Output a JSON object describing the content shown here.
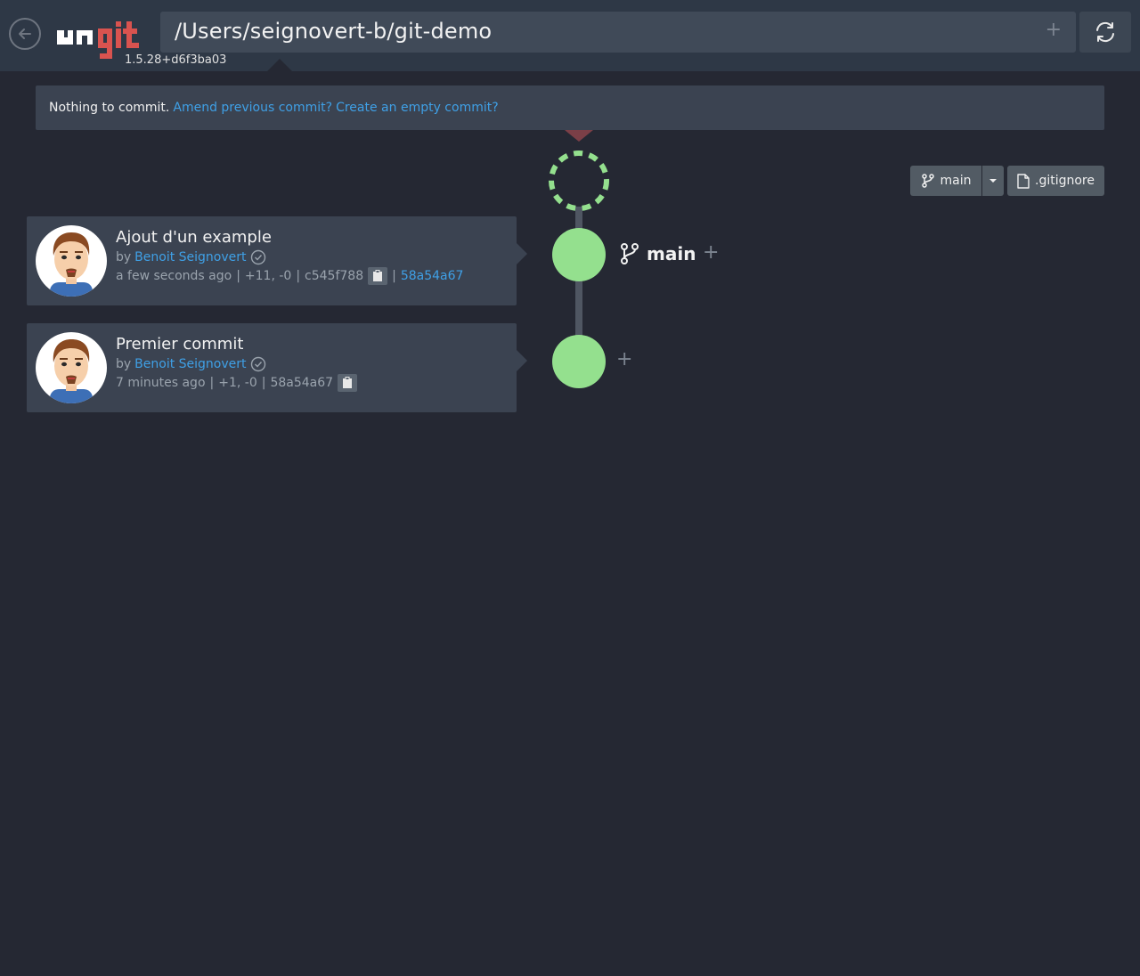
{
  "header": {
    "version": "1.5.28+d6f3ba03",
    "repo_path": "/Users/seignovert-b/git-demo",
    "path_plus": "+"
  },
  "commit_bar": {
    "message": "Nothing to commit.",
    "amend_link": "Amend previous commit?",
    "empty_link": "Create an empty commit?"
  },
  "toolbar": {
    "branch": "main",
    "gitignore": ".gitignore"
  },
  "graph": {
    "branch_label": "main",
    "plus": "+",
    "node_color": "#94e08e"
  },
  "commits": [
    {
      "title": "Ajout d'un example",
      "by": "by",
      "author": "Benoit Seignovert",
      "time": "a few seconds ago",
      "stats": "+11, -0",
      "sha": "c545f788",
      "parent": "58a54a67"
    },
    {
      "title": "Premier commit",
      "by": "by",
      "author": "Benoit Seignovert",
      "time": "7 minutes ago",
      "stats": "+1, -0",
      "sha": "58a54a67"
    }
  ]
}
